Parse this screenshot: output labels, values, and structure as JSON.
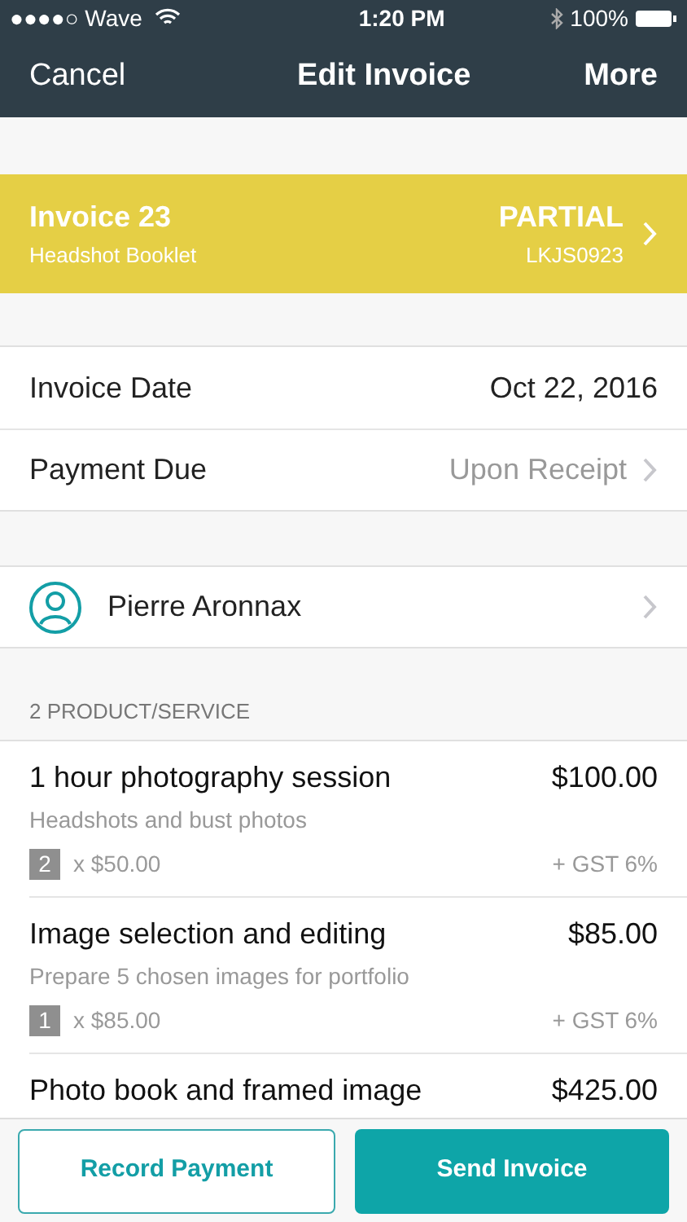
{
  "status_bar": {
    "carrier": "●●●●○ Wave",
    "time": "1:20 PM",
    "battery": "100%"
  },
  "nav": {
    "left": "Cancel",
    "title": "Edit Invoice",
    "right": "More"
  },
  "invoice": {
    "title": "Invoice 23",
    "subtitle": "Headshot Booklet",
    "status": "PARTIAL",
    "code": "LKJS0923"
  },
  "details": [
    {
      "label": "Invoice Date",
      "value": "Oct 22, 2016",
      "chevron": false
    },
    {
      "label": "Payment Due",
      "value": "Upon Receipt",
      "chevron": true
    }
  ],
  "customer": {
    "name": "Pierre Aronnax"
  },
  "items_header": "2 PRODUCT/SERVICE",
  "items": [
    {
      "name": "1 hour photography session",
      "price": "$100.00",
      "description": "Headshots and bust photos",
      "quantity": "2",
      "unit": "x $50.00",
      "tax": "+ GST 6%"
    },
    {
      "name": "Image selection and editing",
      "price": "$85.00",
      "description": "Prepare 5 chosen images for portfolio",
      "quantity": "1",
      "unit": "x $85.00",
      "tax": "+ GST 6%"
    },
    {
      "name": "Photo book and framed image",
      "price": "$425.00"
    }
  ],
  "buttons": {
    "secondary": "Record Payment",
    "primary": "Send Invoice"
  }
}
